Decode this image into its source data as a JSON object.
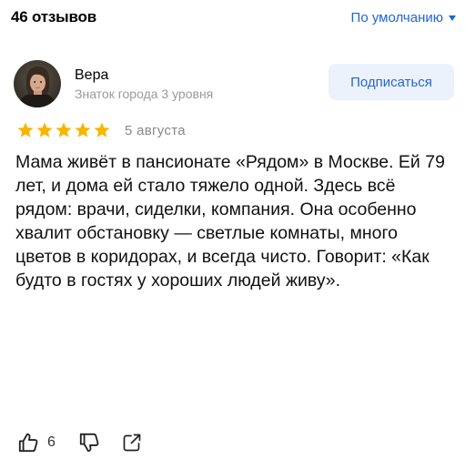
{
  "header": {
    "reviews_count": "46 отзывов",
    "sort_label": "По умолчанию"
  },
  "review": {
    "author_name": "Вера",
    "author_level": "Знаток города 3 уровня",
    "subscribe_label": "Подписаться",
    "rating": 5,
    "rating_max": 5,
    "date": "5 августа",
    "text": "Мама живёт в пансионате «Рядом» в Москве. Ей 79 лет, и дома ей стало тяжело одной. Здесь всё рядом: врачи, сиделки, компания. Она особенно хвалит обстановку — светлые комнаты, много цветов в коридорах, и всегда чисто. Говорит: «Как будто в гостях у хороших людей живу».",
    "likes": "6"
  },
  "icons": {
    "sort": "chevron-down-icon",
    "star": "star-icon",
    "like": "thumbs-up-icon",
    "dislike": "thumbs-down-icon",
    "share": "share-icon"
  },
  "colors": {
    "link_blue": "#1e64d6",
    "subscribe_bg": "#ebf2fc",
    "star_gold": "#f6b600",
    "muted_gray": "#888888"
  }
}
